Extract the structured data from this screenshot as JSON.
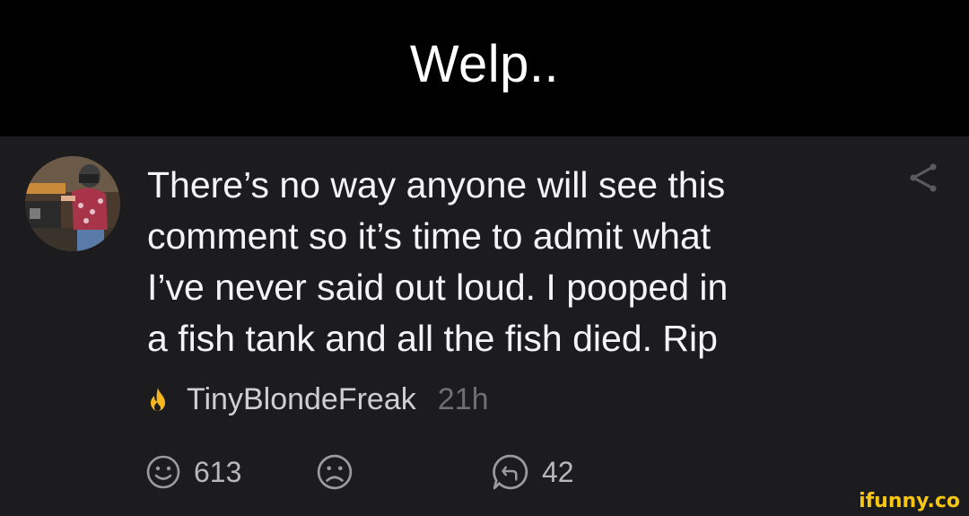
{
  "caption": {
    "text": "Welp.."
  },
  "comment": {
    "text": "There’s no way anyone will see this\ncomment so it’s time to admit what\nI’ve never said out loud. I pooped in\na fish tank and all the fish died. Rip",
    "author": "TinyBlondeFreak",
    "time": "21h",
    "author_badge_icon": "flame-icon",
    "share_icon": "share-icon"
  },
  "actions": {
    "smile_count": "613",
    "reply_count": "42",
    "smile_icon": "smile-icon",
    "unsmile_icon": "unsmile-icon",
    "reply_icon": "reply-icon"
  },
  "watermark": {
    "text": "ifunny.co"
  },
  "colors": {
    "caption_bg": "#000000",
    "comment_bg": "#1c1c1e",
    "comment_text": "#f4f4f4",
    "muted_text": "#6e6e73",
    "flame": "#f7b51e",
    "watermark": "#f7c514"
  }
}
